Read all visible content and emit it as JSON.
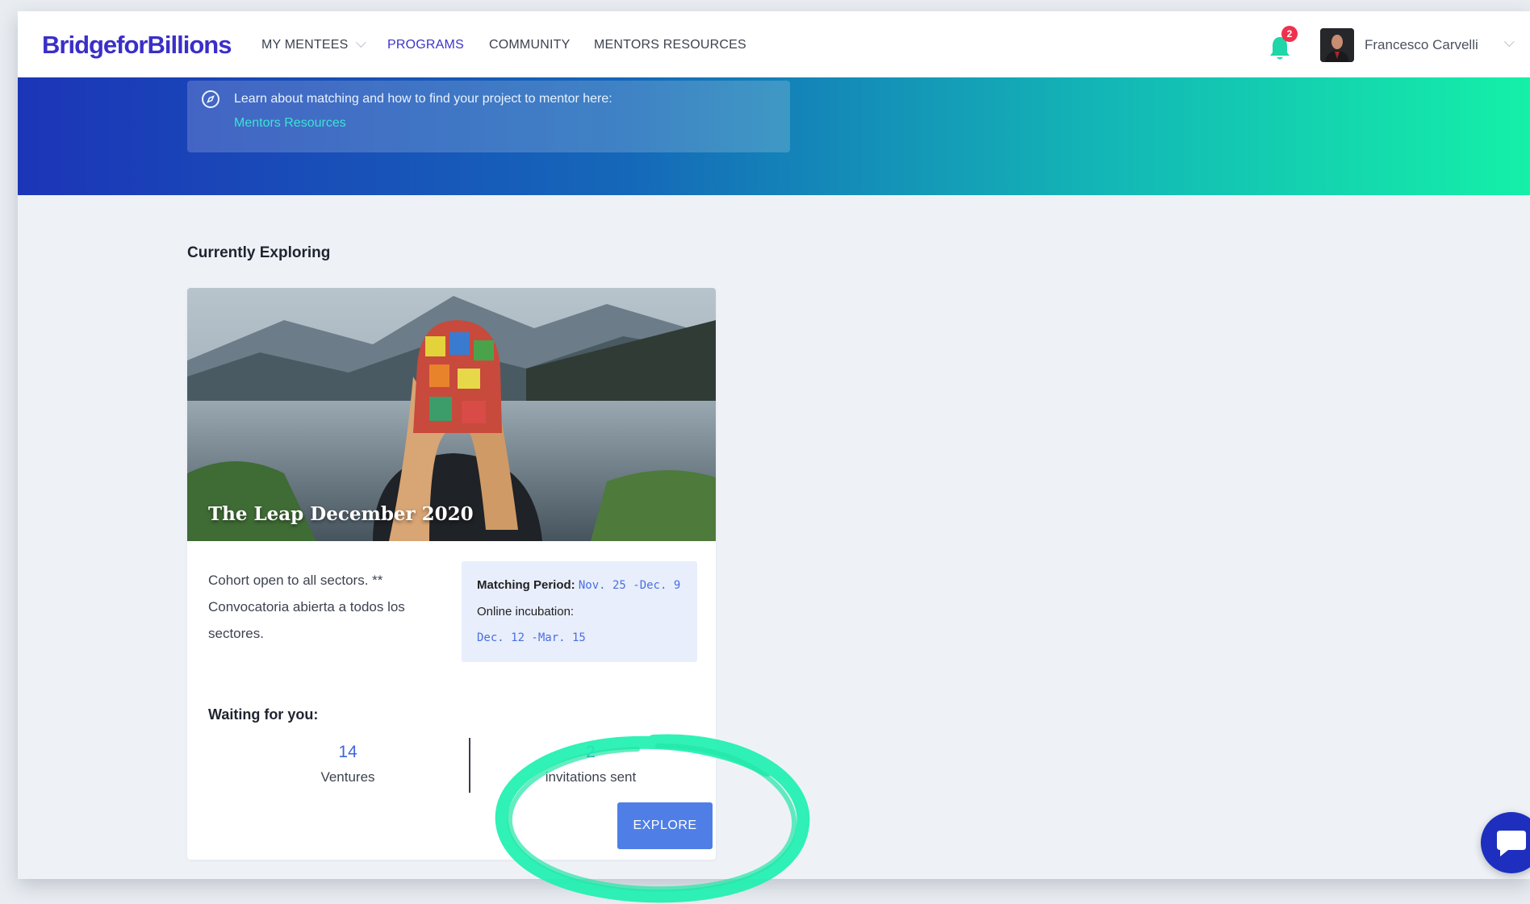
{
  "brand": {
    "logo_text": "BridgeforBillions",
    "logo_color": "#3a2fc8"
  },
  "nav": {
    "items": [
      {
        "label": "MY MENTEES",
        "has_dropdown": true
      },
      {
        "label": "PROGRAMS",
        "active": true
      },
      {
        "label": "COMMUNITY"
      },
      {
        "label": "MENTORS RESOURCES"
      }
    ]
  },
  "header_right": {
    "notification_icon": "bell-icon",
    "notification_count": "2",
    "user_name": "Francesco Carvelli",
    "user_menu_icon": "chevron-down-icon"
  },
  "hero": {
    "info_icon": "compass-icon",
    "info_text": "Learn about matching and how to find your project to mentor here:",
    "info_link": "Mentors Resources",
    "gradient": [
      "#1c35b8",
      "#1567b9",
      "#13b7b6",
      "#14f0a8"
    ]
  },
  "section": {
    "title": "Currently Exploring"
  },
  "program_card": {
    "image_title": "The Leap December 2020",
    "description": "Cohort open to all sectors. ** Convocatoria abierta a todos los sectores.",
    "matching_label": "Matching Period:",
    "matching_value": "Nov. 25 -Dec. 9",
    "incubation_label": "Online incubation:",
    "incubation_value": "Dec. 12 -Mar. 15",
    "waiting_title": "Waiting for you:",
    "stats": [
      {
        "value": "14",
        "label": "Ventures"
      },
      {
        "value": "2",
        "label": "invitations sent"
      }
    ],
    "cta_label": "EXPLORE",
    "cta_color": "#4f7fe6"
  },
  "annotation": {
    "shape": "hand-drawn circle",
    "color": "#1ef0b0"
  },
  "chat": {
    "icon": "chat-bubble-icon",
    "color": "#1e2fbf"
  }
}
